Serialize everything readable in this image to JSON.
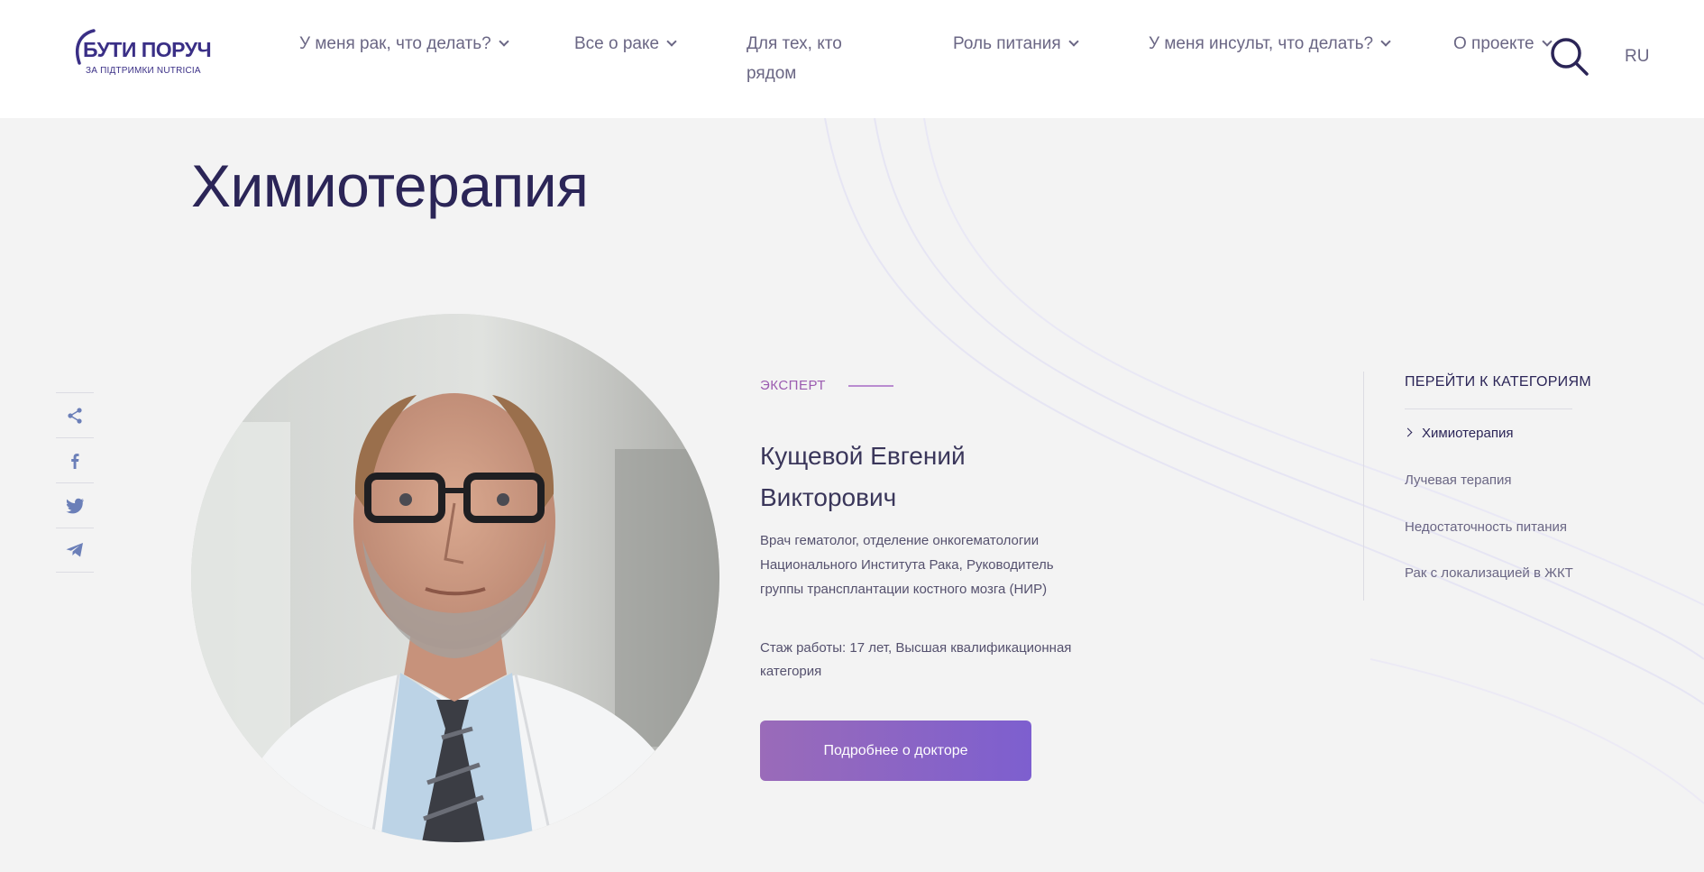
{
  "logo": {
    "main": "БУТИ ПОРУЧ",
    "sub": "ЗА ПІДТРИМКИ NUTRICIA",
    "color": "#3a2f86"
  },
  "nav": [
    {
      "label": "У меня рак, что делать?",
      "dropdown": true
    },
    {
      "label": "Все о раке",
      "dropdown": true
    },
    {
      "label": "Для тех, кто рядом",
      "dropdown": false
    },
    {
      "label": "Роль питания",
      "dropdown": true
    },
    {
      "label": "У меня инсульт, что делать?",
      "dropdown": true
    },
    {
      "label": "О проекте",
      "dropdown": true
    }
  ],
  "header": {
    "search_icon": "search-icon",
    "lang": "RU"
  },
  "page": {
    "title": "Химиотерапия"
  },
  "share": {
    "items": [
      "share-icon",
      "facebook-icon",
      "twitter-icon",
      "telegram-icon"
    ]
  },
  "expert": {
    "label": "ЭКСПЕРТ",
    "name": "Кущевой Евгений Викторович",
    "description": "Врач гематолог, отделение онкогематологии Национального Института Рака, Руководитель группы трансплантации костного мозга (НИР)",
    "experience": "Стаж работы: 17 лет, Высшая квалификационная категория",
    "button": "Подробнее о докторе"
  },
  "categories": {
    "title": "ПЕРЕЙТИ К КАТЕГОРИЯМ",
    "items": [
      {
        "label": "Химиотерапия",
        "active": true
      },
      {
        "label": "Лучевая терапия",
        "active": false
      },
      {
        "label": "Недостаточность питания",
        "active": false
      },
      {
        "label": "Рак с локализацией в ЖКТ",
        "active": false
      }
    ]
  },
  "colors": {
    "accent": "#9b5bb0",
    "button_start": "#9a6bb9",
    "button_end": "#7d5fcf",
    "text_dark": "#2b2557",
    "background": "#f3f3f3"
  }
}
